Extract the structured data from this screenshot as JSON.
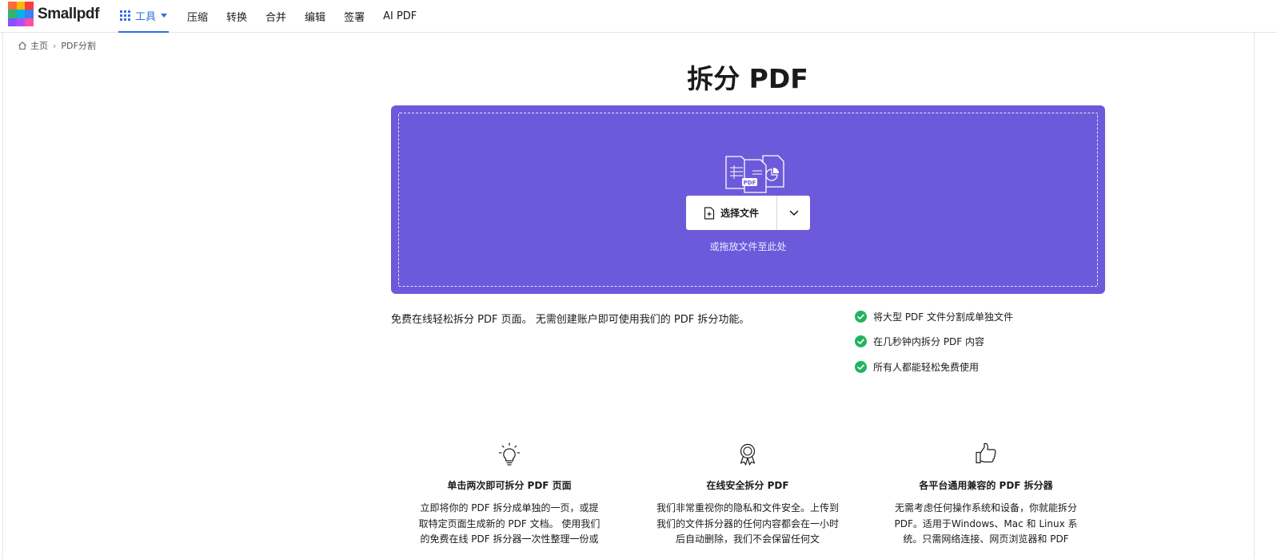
{
  "header": {
    "logo_text": "Smallpdf",
    "logo_colors": [
      "#ff6b3d",
      "#ffb800",
      "#ff3b3b",
      "#2bb673",
      "#00b5e2",
      "#3c7ff6",
      "#8a4fff",
      "#b44cff",
      "#ff4fa3"
    ],
    "nav": {
      "tools_label": "工具",
      "items": [
        "压缩",
        "转换",
        "合并",
        "编辑",
        "签署",
        "AI PDF"
      ]
    }
  },
  "breadcrumb": {
    "home": "主页",
    "separator": "›",
    "current": "PDF分割"
  },
  "main": {
    "title": "拆分 PDF",
    "dropzone": {
      "choose_label": "选择文件",
      "hint": "或拖放文件至此处",
      "file_badge": "PDF",
      "background": "#6d5ada"
    },
    "description": "免费在线轻松拆分 PDF 页面。 无需创建账户即可使用我们的 PDF 拆分功能。",
    "features": [
      "将大型 PDF 文件分割成单独文件",
      "在几秒钟内拆分 PDF 内容",
      "所有人都能轻松免费使用"
    ],
    "feature_check_color": "#22b35e",
    "benefits": [
      {
        "icon": "lightbulb-icon",
        "title": "单击两次即可拆分 PDF 页面",
        "text": "立即将你的 PDF 拆分成单独的一页，或提取特定页面生成新的 PDF 文档。 使用我们的免费在线 PDF 拆分器一次性整理一份或"
      },
      {
        "icon": "award-icon",
        "title": "在线安全拆分 PDF",
        "text": "我们非常重视你的隐私和文件安全。上传到我们的文件拆分器的任何内容都会在一小时后自动删除，我们不会保留任何文"
      },
      {
        "icon": "thumbs-up-icon",
        "title": "各平台通用兼容的 PDF 拆分器",
        "text": "无需考虑任何操作系统和设备，你就能拆分 PDF。适用于Windows、Mac 和 Linux 系统。只需网络连接、网页浏览器和 PDF"
      }
    ]
  }
}
